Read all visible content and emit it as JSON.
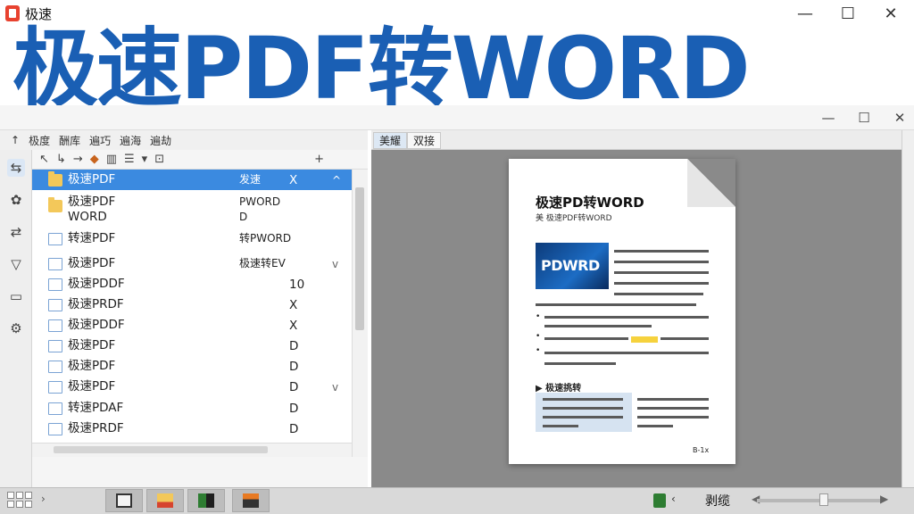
{
  "window": {
    "title": "极速",
    "minimize": "—",
    "maximize": "☐",
    "close": "✕"
  },
  "headline": "极速PDF转WORD",
  "inner_window": {
    "minimize": "—",
    "maximize": "☐",
    "close": "✕"
  },
  "menu": [
    "极度",
    "酬库",
    "遍巧",
    "遍海",
    "遍劫"
  ],
  "list": {
    "rows": [
      {
        "name": "极速PDF",
        "mid": "发速",
        "val": "X",
        "icon": "folder",
        "chev": "^",
        "selected": true
      },
      {
        "name": "极速PDF\nWORD",
        "mid": "PWORD\nD",
        "val": "",
        "icon": "folder",
        "chev": ""
      },
      {
        "name": "转速PDF",
        "mid": "转PWORD",
        "val": "",
        "icon": "file",
        "chev": ""
      },
      {
        "name": "极速PDF",
        "mid": "极速转EV",
        "val": "",
        "icon": "file",
        "chev": "v"
      },
      {
        "name": "极速PDDF",
        "mid": "",
        "val": "10",
        "icon": "file",
        "chev": ""
      },
      {
        "name": "极速PRDF",
        "mid": "",
        "val": "X",
        "icon": "file",
        "chev": ""
      },
      {
        "name": "极速PDDF",
        "mid": "",
        "val": "X",
        "icon": "file",
        "chev": ""
      },
      {
        "name": "极速PDF",
        "mid": "",
        "val": "D",
        "icon": "file",
        "chev": ""
      },
      {
        "name": "极速PDF",
        "mid": "",
        "val": "D",
        "icon": "file",
        "chev": ""
      },
      {
        "name": "极速PDF",
        "mid": "",
        "val": "D",
        "icon": "file",
        "chev": "v"
      },
      {
        "name": "转速PDAF",
        "mid": "",
        "val": "D",
        "icon": "file",
        "chev": ""
      },
      {
        "name": "极速PRDF",
        "mid": "",
        "val": "D",
        "icon": "file",
        "chev": ""
      }
    ]
  },
  "tabs": [
    "美耀",
    "双接"
  ],
  "document": {
    "title": "极速PD转WORD",
    "subtitle": "美 极速PDF转WORD",
    "thumb_text": "PDWRD",
    "section": "▶ 极速挑转",
    "page_num": "B-1x"
  },
  "status": {
    "text": "剥缆"
  },
  "colors": {
    "headline": "#1a5fb4",
    "selection": "#3b8ae0",
    "preview_bg": "#8a8a8a"
  }
}
